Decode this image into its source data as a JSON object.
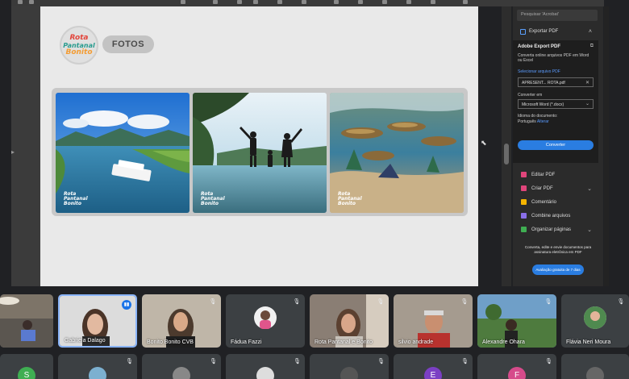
{
  "document": {
    "logo_lines": [
      "Rota",
      "Pantanal",
      "Bonito"
    ],
    "section_label": "FOTOS",
    "photos": [
      {
        "scene": "river-boat",
        "watermark": [
          "Rota",
          "Pantanal",
          "Bonito"
        ]
      },
      {
        "scene": "family-silhouette",
        "watermark": [
          "Rota",
          "Pantanal",
          "Bonito"
        ]
      },
      {
        "scene": "fish-underwater",
        "watermark": [
          "Rota",
          "Pantanal",
          "Bonito"
        ]
      }
    ]
  },
  "panel": {
    "search_placeholder": "Pesquisar 'Acrobat'",
    "export_title": "Exportar PDF",
    "card_title": "Adobe Export PDF",
    "card_desc": "Converta online arquivos PDF em Word ou Excel",
    "select_file_label": "Selecionar arquivo PDF",
    "file_name": "APRESENT... ROTA.pdf",
    "convert_to_label": "Converter em",
    "convert_to_value": "Microsoft Word (*.docx)",
    "language_label": "Idioma do documento:",
    "language_value": "Português",
    "language_change": "Alterar",
    "convert_button": "Converter",
    "tools": [
      {
        "label": "Editar PDF",
        "icon": "edit-pdf-icon",
        "color": "#e0457b",
        "chevron": false
      },
      {
        "label": "Criar PDF",
        "icon": "create-pdf-icon",
        "color": "#e0457b",
        "chevron": true
      },
      {
        "label": "Comentário",
        "icon": "comment-icon",
        "color": "#f5b400",
        "chevron": false
      },
      {
        "label": "Combine arquivos",
        "icon": "combine-icon",
        "color": "#8a6fe8",
        "chevron": false
      },
      {
        "label": "Organizar páginas",
        "icon": "organize-icon",
        "color": "#3fae52",
        "chevron": true
      }
    ],
    "promo_text": "Converta, edite e envie documentos para assinatura eletrônica em PDF",
    "promo_button": "Avaliação gratuita de 7 dias"
  },
  "participants": [
    {
      "name": "",
      "muted": false,
      "speaking": false
    },
    {
      "name": "Gabriela Dalago",
      "muted": false,
      "speaking": true
    },
    {
      "name": "Bonito Bonito CVB",
      "muted": true,
      "speaking": false
    },
    {
      "name": "Fádua Fazzi",
      "muted": true,
      "speaking": false
    },
    {
      "name": "Rota Pantanal e Bonito",
      "muted": true,
      "speaking": false
    },
    {
      "name": "silvio andrade",
      "muted": true,
      "speaking": false
    },
    {
      "name": "Alexandre Ohara",
      "muted": true,
      "speaking": false
    },
    {
      "name": "Flávia Neri Moura",
      "muted": true,
      "speaking": false
    }
  ],
  "second_row": [
    {
      "initial": "S",
      "color": "#3fae52"
    },
    {
      "initial": "",
      "color": "#7cb0d0"
    },
    {
      "initial": "",
      "color": "#888"
    },
    {
      "initial": "",
      "color": "#ddd"
    },
    {
      "initial": "",
      "color": "#555"
    },
    {
      "initial": "E",
      "color": "#7b3fc4"
    },
    {
      "initial": "F",
      "color": "#d64b8b"
    },
    {
      "initial": "",
      "color": "#666"
    }
  ]
}
